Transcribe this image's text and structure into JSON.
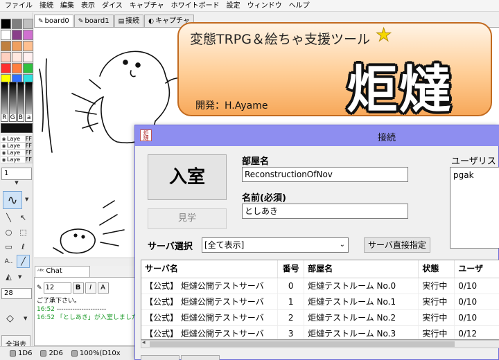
{
  "menu": [
    "ファイル",
    "接続",
    "編集",
    "表示",
    "ダイス",
    "キャプチャ",
    "ホワイトボード",
    "設定",
    "ウィンドウ",
    "ヘルプ"
  ],
  "palette": [
    "#000000",
    "#7f7f7f",
    "#c0c0c0",
    "#ffffff",
    "#8a3f8a",
    "#d070d0",
    "#c08040",
    "#f0a060",
    "#ffc090",
    "#ffd0c0",
    "#ffe8e0",
    "#fff0f0",
    "#ff3030",
    "#ff8040",
    "#30c040",
    "#ffff00",
    "#3070ff",
    "#30e0e0"
  ],
  "color_bars": [
    "R",
    "G",
    "B",
    "a"
  ],
  "layers": [
    {
      "name": "Laye",
      "alpha": "FF"
    },
    {
      "name": "Laye",
      "alpha": "FF"
    },
    {
      "name": "Laye",
      "alpha": "FF"
    },
    {
      "name": "Laye",
      "alpha": "FF"
    }
  ],
  "pen_number": "1",
  "pen_size": "28",
  "clear_all_label": "全消去",
  "tabs": [
    {
      "label": "board0",
      "icon": "✎"
    },
    {
      "label": "board1",
      "icon": "✎"
    },
    {
      "label": "接続",
      "icon": "▤"
    },
    {
      "label": "キャプチャ",
      "icon": "◐"
    }
  ],
  "chat": {
    "tab_label": "Chat",
    "font_size": "12",
    "format_buttons": [
      "B",
      "I",
      "A"
    ],
    "lines": [
      {
        "time": "",
        "text": "ご了承下さい。"
      },
      {
        "time": "16:52",
        "text": "----------------------"
      },
      {
        "time": "16:52",
        "text": "「としあき」が入室しました"
      }
    ]
  },
  "statusbar": {
    "dice1": "1D6",
    "dice2": "2D6",
    "zoom": "100%(D10x"
  },
  "banner": {
    "subtitle": "変態TRPG＆絵ちゃ支援ツール",
    "logo": "炬燵",
    "developer": "開発：H.Ayame"
  },
  "dialog": {
    "title": "接続",
    "icon_text": "炬燵",
    "enter_label": "入室",
    "watch_label": "見学",
    "room_name_label": "部屋名",
    "room_name_value": "ReconstructionOfNov",
    "name_label": "名前(必須)",
    "name_value": "としあき",
    "user_list_label": "ユーザリスト",
    "users": [
      "pgak"
    ],
    "server_select_label": "サーバ選択",
    "server_select_value": "[全て表示]",
    "direct_label": "サーバ直接指定",
    "columns": [
      "サーバ名",
      "番号",
      "部屋名",
      "状態",
      "ユーザ"
    ],
    "rows": [
      {
        "server": "【公式】 炬燵公開テストサーバ",
        "no": "0",
        "room": "炬燵テストルーム No.0",
        "status": "実行中",
        "users": "0/10"
      },
      {
        "server": "【公式】 炬燵公開テストサーバ",
        "no": "1",
        "room": "炬燵テストルーム No.1",
        "status": "実行中",
        "users": "0/10"
      },
      {
        "server": "【公式】 炬燵公開テストサーバ",
        "no": "2",
        "room": "炬燵テストルーム No.2",
        "status": "実行中",
        "users": "0/10"
      },
      {
        "server": "【公式】 炬燵公開テストサーバ",
        "no": "3",
        "room": "炬燵テストルーム No.3",
        "status": "実行中",
        "users": "0/12"
      }
    ]
  }
}
